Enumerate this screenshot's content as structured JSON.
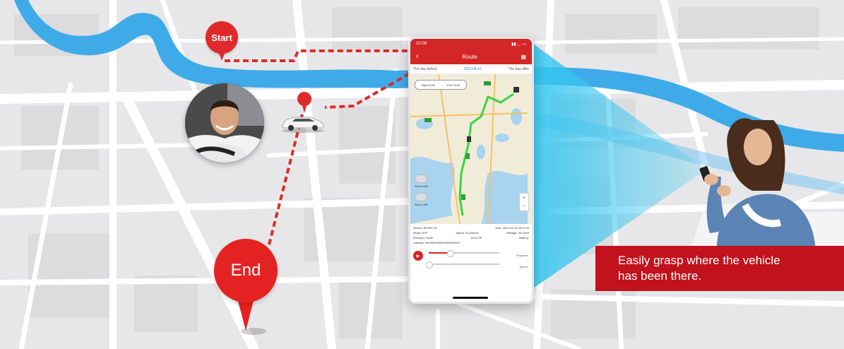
{
  "pins": {
    "start_label": "Start",
    "end_label": "End"
  },
  "colors": {
    "route_red": "#e02a2a",
    "caption_bg": "#c1121d",
    "river": "#2ea6e6",
    "beam": "#3cc9f0",
    "track_green": "#39d639"
  },
  "phone": {
    "status_time": "10:06",
    "title": "Route",
    "prev_day": "The day before",
    "current_date": "2022-04-10",
    "next_day": "The day after",
    "time_start": "Start 00:00",
    "time_end": "End 23:59",
    "toggle_1": "Show WiFi",
    "toggle_2": "Show LBS",
    "info_device": "Device: WP900 4G",
    "info_time": "Time: 2022-04-10 16:37:00",
    "info_mode": "Mode: GPS",
    "info_speed": "Speed: 53.00km/h",
    "info_mileage": "Mileage: 36.23km",
    "info_direction": "Direction: South",
    "info_acc": "ACC:Off",
    "info_battery": "Battery:",
    "info_address": "Address: 0000000000000000000000",
    "progress_label": "Progress",
    "speed_label": "Speed",
    "progress_fraction": 0.3,
    "speed_fraction": 0.0
  },
  "caption": {
    "line1": "Easily grasp where the vehicle",
    "line2": "has been there."
  },
  "icons": {
    "back": "chevron-left-icon",
    "calendar": "calendar-icon",
    "play": "play-icon"
  }
}
